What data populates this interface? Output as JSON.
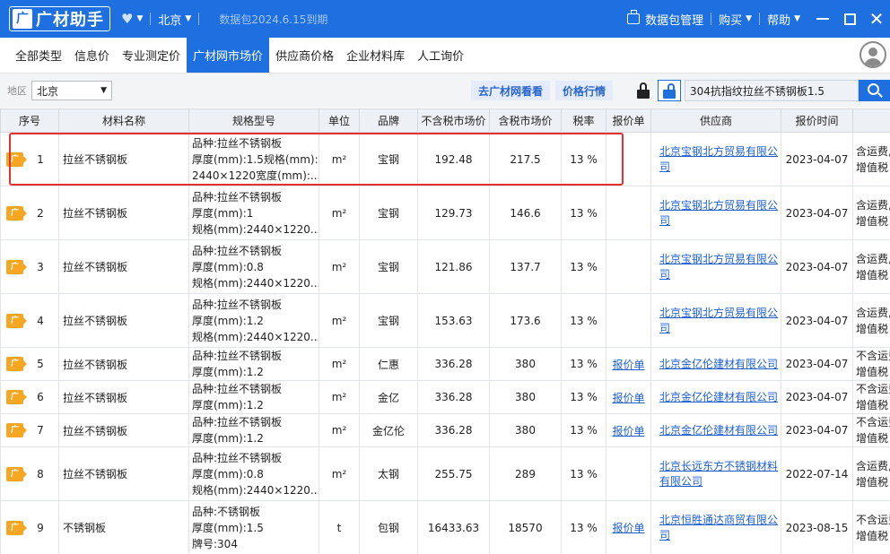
{
  "app": {
    "logo_char": "广",
    "name": "广材助手",
    "city": "北京",
    "expire": "数据包2024.6.15到期",
    "data_pkg_mgmt": "数据包管理",
    "buy": "购买",
    "help": "帮助"
  },
  "tabs": [
    {
      "label": "全部类型",
      "active": false
    },
    {
      "label": "信息价",
      "active": false
    },
    {
      "label": "专业测定价",
      "active": false
    },
    {
      "label": "广材网市场价",
      "active": true
    },
    {
      "label": "供应商价格",
      "active": false
    },
    {
      "label": "企业材料库",
      "active": false
    },
    {
      "label": "人工询价",
      "active": false
    }
  ],
  "filter": {
    "area_label": "地区",
    "area_value": "北京",
    "goto_site": "去广材网看看",
    "price_trend": "价格行情",
    "search_value": "304抗指纹拉丝不锈钢板1.5"
  },
  "table": {
    "headers": [
      "序号",
      "材料名称",
      "规格型号",
      "单位",
      "品牌",
      "不含税市场价",
      "含税市场价",
      "税率",
      "报价单",
      "供应商",
      "报价时间",
      ""
    ],
    "tag_char": "广",
    "rows": [
      {
        "seq": "1",
        "name": "拉丝不锈钢板",
        "spec": [
          "品种:拉丝不锈钢板",
          "厚度(mm):1.5规格(mm):",
          "2440×1220宽度(mm):..."
        ],
        "unit": "m²",
        "brand": "宝钢",
        "price_ex": "192.48",
        "price_in": "217.5",
        "tax": "13 %",
        "quote": "",
        "supplier": "北京宝钢北方贸易有限公司",
        "date": "2023-04-07",
        "note": [
          "含运费,",
          "增值税"
        ]
      },
      {
        "seq": "2",
        "name": "拉丝不锈钢板",
        "spec": [
          "品种:拉丝不锈钢板",
          "厚度(mm):1",
          "规格(mm):2440×1220..."
        ],
        "unit": "m²",
        "brand": "宝钢",
        "price_ex": "129.73",
        "price_in": "146.6",
        "tax": "13 %",
        "quote": "",
        "supplier": "北京宝钢北方贸易有限公司",
        "date": "2023-04-07",
        "note": [
          "含运费,",
          "增值税"
        ]
      },
      {
        "seq": "3",
        "name": "拉丝不锈钢板",
        "spec": [
          "品种:拉丝不锈钢板",
          "厚度(mm):0.8",
          "规格(mm):2440×1220..."
        ],
        "unit": "m²",
        "brand": "宝钢",
        "price_ex": "121.86",
        "price_in": "137.7",
        "tax": "13 %",
        "quote": "",
        "supplier": "北京宝钢北方贸易有限公司",
        "date": "2023-04-07",
        "note": [
          "含运费,",
          "增值税"
        ]
      },
      {
        "seq": "4",
        "name": "拉丝不锈钢板",
        "spec": [
          "品种:拉丝不锈钢板",
          "厚度(mm):1.2",
          "规格(mm):2440×1220..."
        ],
        "unit": "m²",
        "brand": "宝钢",
        "price_ex": "153.63",
        "price_in": "173.6",
        "tax": "13 %",
        "quote": "",
        "supplier": "北京宝钢北方贸易有限公司",
        "date": "2023-04-07",
        "note": [
          "含运费,",
          "增值税"
        ]
      },
      {
        "seq": "5",
        "name": "拉丝不锈钢板",
        "spec": [
          "品种:拉丝不锈钢板",
          "厚度(mm):1.2"
        ],
        "unit": "m²",
        "brand": "仁惠",
        "price_ex": "336.28",
        "price_in": "380",
        "tax": "13 %",
        "quote": "报价单",
        "supplier": "北京金亿伦建材有限公司",
        "date": "2023-04-07",
        "note": [
          "不含运费",
          "增值税"
        ]
      },
      {
        "seq": "6",
        "name": "拉丝不锈钢板",
        "spec": [
          "品种:拉丝不锈钢板",
          "厚度(mm):1.2"
        ],
        "unit": "m²",
        "brand": "金亿",
        "price_ex": "336.28",
        "price_in": "380",
        "tax": "13 %",
        "quote": "报价单",
        "supplier": "北京金亿伦建材有限公司",
        "date": "2023-04-07",
        "note": [
          "不含运费",
          "增值税"
        ]
      },
      {
        "seq": "7",
        "name": "拉丝不锈钢板",
        "spec": [
          "品种:拉丝不锈钢板",
          "厚度(mm):1.2"
        ],
        "unit": "m²",
        "brand": "金亿伦",
        "price_ex": "336.28",
        "price_in": "380",
        "tax": "13 %",
        "quote": "报价单",
        "supplier": "北京金亿伦建材有限公司",
        "date": "2023-04-07",
        "note": [
          "不含运费",
          "增值税"
        ]
      },
      {
        "seq": "8",
        "name": "拉丝不锈钢板",
        "spec": [
          "品种:拉丝不锈钢板",
          "厚度(mm):0.8",
          "规格(mm):2440×1220..."
        ],
        "unit": "m²",
        "brand": "太钢",
        "price_ex": "255.75",
        "price_in": "289",
        "tax": "13 %",
        "quote": "",
        "supplier": "北京长远东方不锈钢材料有限公司",
        "date": "2022-07-14",
        "note": [
          "含运费,",
          "增值税"
        ]
      },
      {
        "seq": "9",
        "name": "不锈钢板",
        "spec": [
          "品种:不锈钢板",
          "厚度(mm):1.5",
          "牌号:304"
        ],
        "unit": "t",
        "brand": "包钢",
        "price_ex": "16433.63",
        "price_in": "18570",
        "tax": "13 %",
        "quote": "报价单",
        "supplier": "北京恒胜通达商贸有限公司",
        "date": "2023-08-15",
        "note": [
          "不含运费",
          "增值税"
        ]
      }
    ]
  },
  "colors": {
    "primary": "#1e6fe0",
    "tag": "#f5a623",
    "highlight": "#e53030",
    "link": "#1e5fd0"
  }
}
